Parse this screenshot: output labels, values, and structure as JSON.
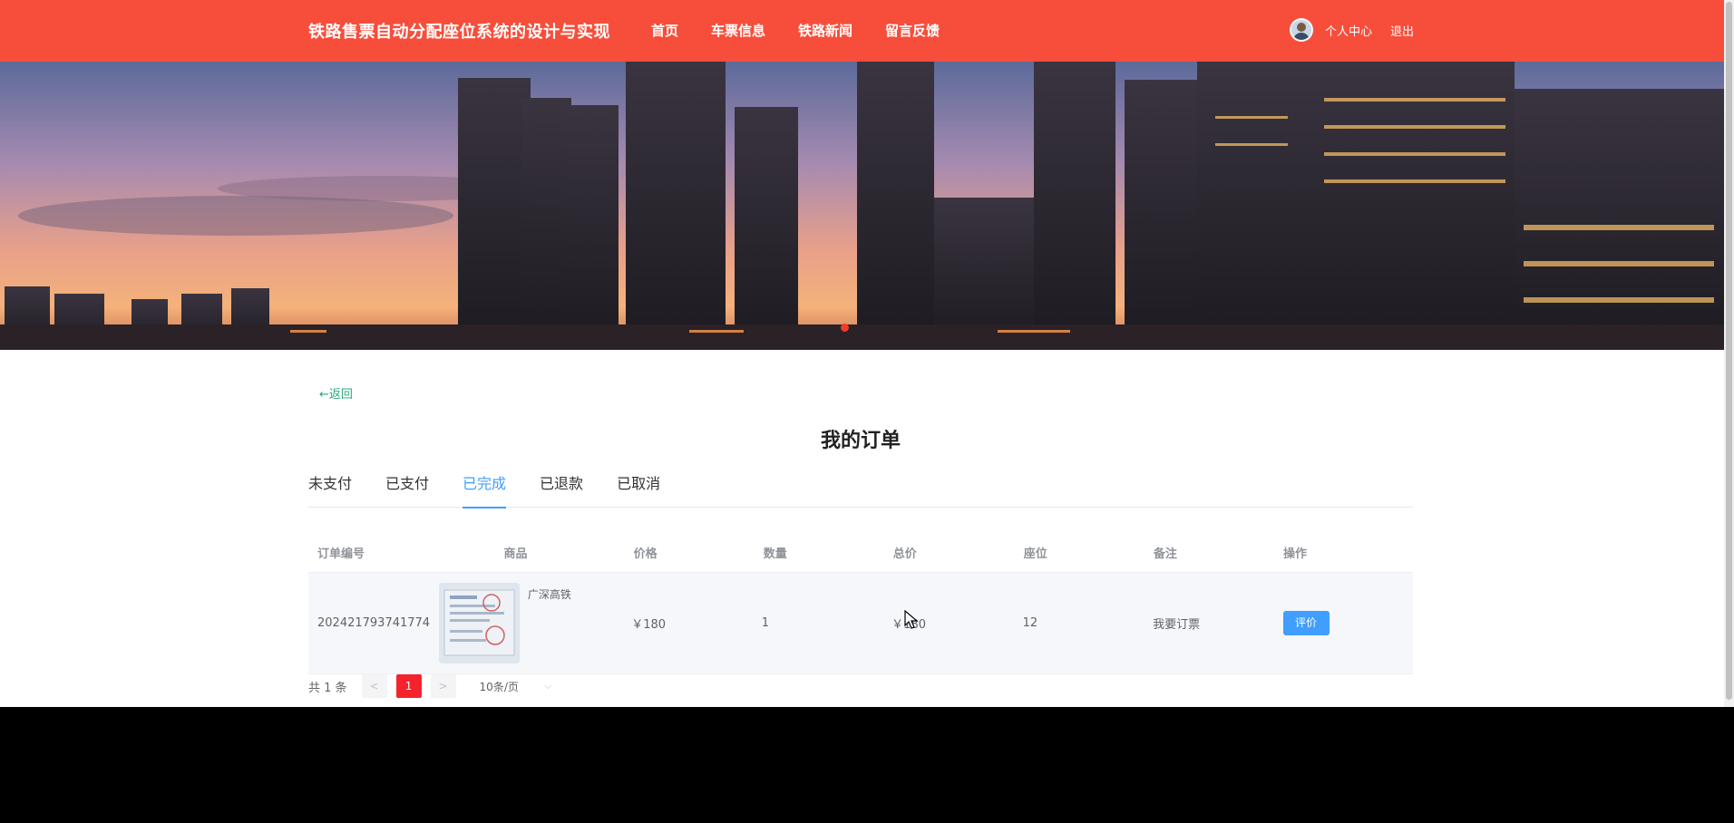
{
  "header": {
    "site_title": "铁路售票自动分配座位系统的设计与实现",
    "nav": [
      {
        "label": "首页"
      },
      {
        "label": "车票信息"
      },
      {
        "label": "铁路新闻"
      },
      {
        "label": "留言反馈"
      }
    ],
    "user_center": "个人中心",
    "logout": "退出",
    "color": "#f74e3b"
  },
  "page": {
    "back": "←返回",
    "title": "我的订单"
  },
  "tabs": [
    {
      "label": "未支付",
      "active": false
    },
    {
      "label": "已支付",
      "active": false
    },
    {
      "label": "已完成",
      "active": true
    },
    {
      "label": "已退款",
      "active": false
    },
    {
      "label": "已取消",
      "active": false
    }
  ],
  "table": {
    "columns": [
      "订单编号",
      "商品",
      "价格",
      "数量",
      "总价",
      "座位",
      "备注",
      "操作"
    ],
    "rows": [
      {
        "order_no": "202421793741774",
        "goods_name": "广深高铁",
        "price": "￥180",
        "quantity": "1",
        "total": "￥180",
        "seat": "12",
        "remark": "我要订票",
        "action": "评价"
      }
    ]
  },
  "pagination": {
    "total": "共 1 条",
    "prev": "<",
    "current": "1",
    "next": ">",
    "page_size": "10条/页"
  },
  "colors": {
    "accent": "#409eff",
    "link": "#2aa67e",
    "page_active": "#f5222d"
  }
}
